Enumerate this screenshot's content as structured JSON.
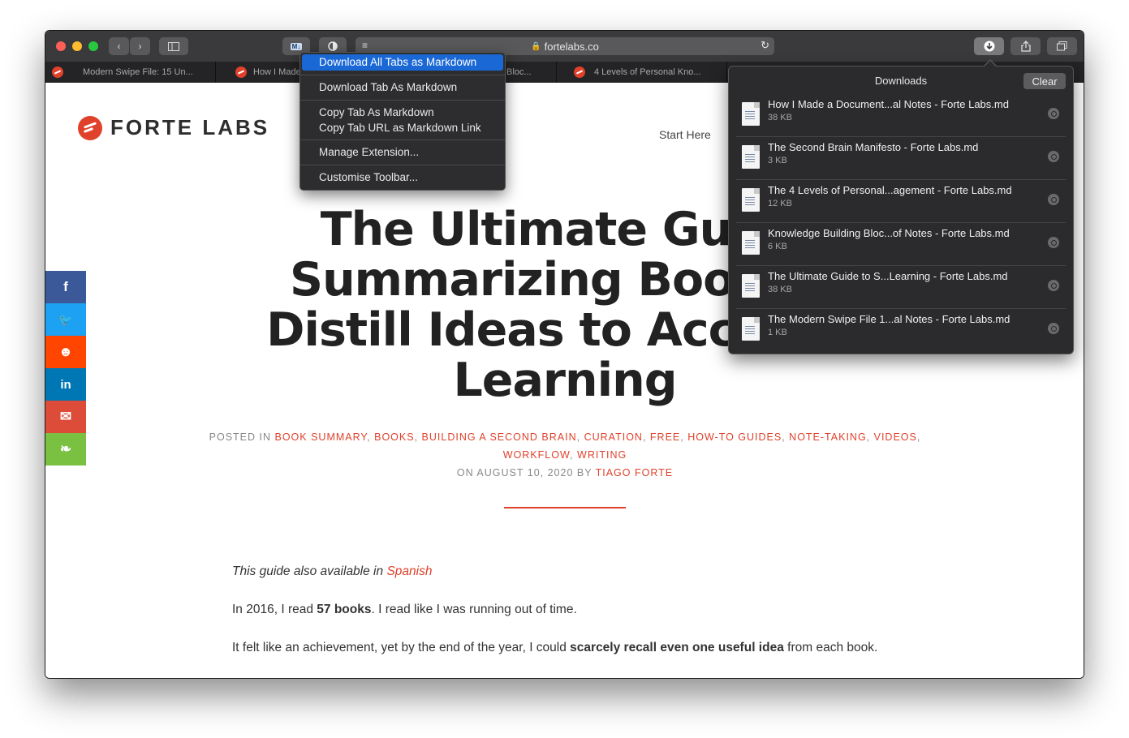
{
  "browser": {
    "url": "fortelabs.co",
    "ext_button_label": "M↓",
    "tabs": [
      {
        "label": "Modern Swipe File: 15 Un..."
      },
      {
        "label": "How I Made"
      },
      {
        "label": "Bloc..."
      },
      {
        "label": "4 Levels of Personal Kno..."
      }
    ]
  },
  "extension_menu": {
    "items": [
      "Download All Tabs as Markdown",
      "Download Tab As Markdown",
      "Copy Tab As Markdown",
      "Copy Tab URL as Markdown Link",
      "Manage Extension...",
      "Customise Toolbar..."
    ]
  },
  "downloads": {
    "title": "Downloads",
    "clear_label": "Clear",
    "items": [
      {
        "name": "How I Made a Document...al Notes - Forte Labs.md",
        "size": "38 KB"
      },
      {
        "name": "The Second Brain Manifesto - Forte Labs.md",
        "size": "3 KB"
      },
      {
        "name": "The 4 Levels of Personal...agement - Forte Labs.md",
        "size": "12 KB"
      },
      {
        "name": "Knowledge Building Bloc...of Notes - Forte Labs.md",
        "size": "6 KB"
      },
      {
        "name": "The Ultimate Guide to S...Learning - Forte Labs.md",
        "size": "38 KB"
      },
      {
        "name": "The Modern Swipe File 1...al Notes - Forte Labs.md",
        "size": "1 KB"
      }
    ]
  },
  "page": {
    "logo_text": "FORTE LABS",
    "nav_start": "Start Here",
    "headline": [
      "The Ultimate Guide",
      "Summarizing Books: I",
      "Distill Ideas to Accelera",
      "Learning"
    ],
    "posted_in_label": "POSTED IN",
    "categories": [
      "BOOK SUMMARY",
      "BOOKS",
      "BUILDING A SECOND BRAIN",
      "CURATION",
      "FREE",
      "HOW-TO GUIDES",
      "NOTE-TAKING",
      "VIDEOS",
      "WORKFLOW",
      "WRITING"
    ],
    "date_line": "ON AUGUST 10, 2020 BY",
    "author": "TIAGO FORTE",
    "para1_text": "This guide also available in",
    "para1_link": "Spanish",
    "para2_a": "In 2016, I read",
    "para2_bold": "57 books",
    "para2_b": ". I read like I was running out of time.",
    "para3_a": "It felt like an achievement, yet by the end of the year, I could",
    "para3_bold": "scarcely recall even one useful idea",
    "para3_b": "from each book."
  },
  "social": [
    {
      "icon": "facebook-icon",
      "glyph": "f",
      "color": "#3b5998"
    },
    {
      "icon": "twitter-icon",
      "glyph": "🐦",
      "color": "#1da1f2"
    },
    {
      "icon": "reddit-icon",
      "glyph": "☻",
      "color": "#ff4500"
    },
    {
      "icon": "linkedin-icon",
      "glyph": "in",
      "color": "#0077b5"
    },
    {
      "icon": "email-icon",
      "glyph": "✉",
      "color": "#dd4b39"
    },
    {
      "icon": "evernote-icon",
      "glyph": "❧",
      "color": "#7ac142"
    }
  ],
  "colors": {
    "accent": "#e0412a",
    "menu_highlight": "#1a68d6"
  }
}
